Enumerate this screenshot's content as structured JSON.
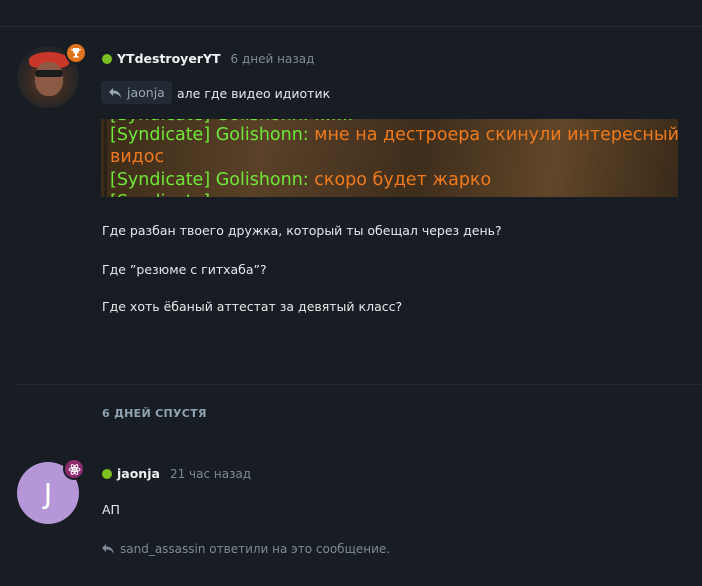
{
  "post1": {
    "username": "YTdestroyerYT",
    "time": "6 дней назад",
    "online_color": "#7cc11f",
    "badge_icon": "trophy-icon",
    "reply_to": "jaonja",
    "reply_text": "але где видео идиотик",
    "screenshot_lines": [
      {
        "name": "[Syndicate] Golishonn:",
        "text": " мне на дестроера скинули интересный"
      },
      {
        "name": "",
        "text": "видос"
      },
      {
        "name": "[Syndicate] Golishonn:",
        "text": " скоро будет жарко"
      }
    ],
    "paragraphs": [
      "Где разбан твоего дружка, который ты обещал через день?",
      "Где ”резюме с гитхаба”?",
      "Где хоть ёбаный аттестат за девятый класс?"
    ]
  },
  "separator": "6 ДНЕЙ СПУСТЯ",
  "post2": {
    "avatar_letter": "J",
    "avatar_color": "#b597d8",
    "badge_icon": "atom-icon",
    "username": "jaonja",
    "time": "21 час назад",
    "text": "АП",
    "replied_note": "sand_assassin ответили на это сообщение."
  }
}
